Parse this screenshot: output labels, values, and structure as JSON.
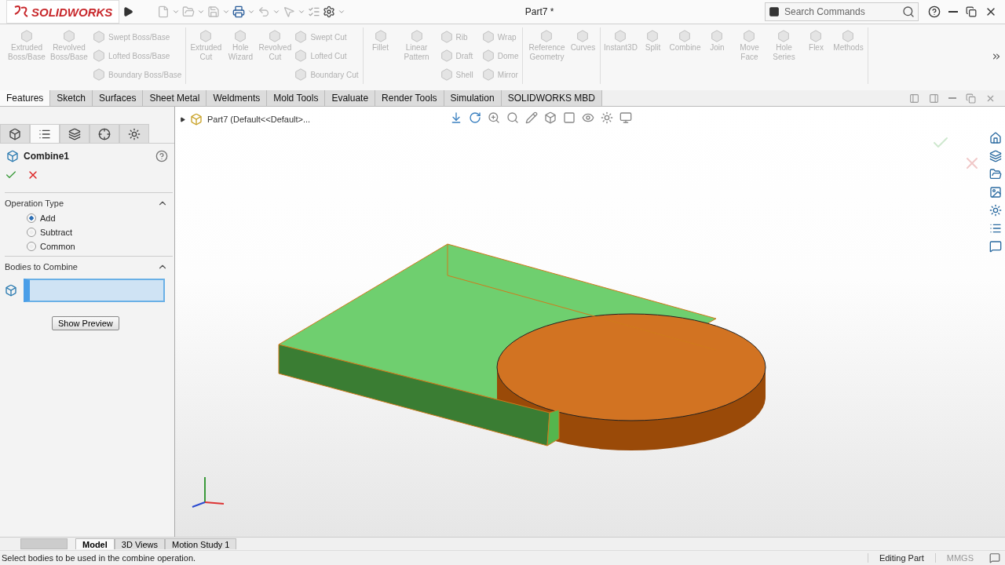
{
  "title_bar": {
    "app_name": "SOLIDWORKS",
    "document_title": "Part7 *",
    "search": {
      "placeholder": "Search Commands"
    }
  },
  "ribbon": [
    {
      "items": [
        {
          "label": "Extruded Boss/Base",
          "kind": "large",
          "disabled": true
        },
        {
          "label": "Revolved Boss/Base",
          "kind": "large",
          "disabled": true
        },
        {
          "label": "Swept Boss/Base",
          "kind": "small",
          "disabled": true
        },
        {
          "label": "Lofted Boss/Base",
          "kind": "small",
          "disabled": true
        },
        {
          "label": "Boundary Boss/Base",
          "kind": "small",
          "disabled": true
        }
      ]
    },
    {
      "items": [
        {
          "label": "Extruded Cut",
          "kind": "large",
          "disabled": true
        },
        {
          "label": "Hole Wizard",
          "kind": "large",
          "disabled": true
        },
        {
          "label": "Revolved Cut",
          "kind": "large",
          "disabled": true
        },
        {
          "label": "Swept Cut",
          "kind": "small",
          "disabled": true
        },
        {
          "label": "Lofted Cut",
          "kind": "small",
          "disabled": true
        },
        {
          "label": "Boundary Cut",
          "kind": "small",
          "disabled": true
        }
      ]
    },
    {
      "items": [
        {
          "label": "Fillet",
          "kind": "large",
          "disabled": true
        },
        {
          "label": "Linear Pattern",
          "kind": "large",
          "disabled": true
        },
        {
          "label": "Rib",
          "kind": "small",
          "disabled": true
        },
        {
          "label": "Draft",
          "kind": "small",
          "disabled": true
        },
        {
          "label": "Shell",
          "kind": "small",
          "disabled": true
        },
        {
          "label": "Wrap",
          "kind": "small",
          "disabled": true
        },
        {
          "label": "Dome",
          "kind": "small",
          "disabled": true
        },
        {
          "label": "Mirror",
          "kind": "small",
          "disabled": true
        }
      ]
    },
    {
      "items": [
        {
          "label": "Reference Geometry",
          "kind": "large",
          "disabled": true
        },
        {
          "label": "Curves",
          "kind": "large",
          "disabled": true
        }
      ]
    },
    {
      "items": [
        {
          "label": "Instant3D",
          "kind": "large",
          "disabled": true
        },
        {
          "label": "Split",
          "kind": "large",
          "disabled": true
        },
        {
          "label": "Combine",
          "kind": "large",
          "disabled": true
        },
        {
          "label": "Join",
          "kind": "large",
          "disabled": true
        },
        {
          "label": "Move Face",
          "kind": "large",
          "disabled": true
        },
        {
          "label": "Hole Series",
          "kind": "large",
          "disabled": true
        },
        {
          "label": "Flex",
          "kind": "large",
          "disabled": true
        },
        {
          "label": "Methods",
          "kind": "large",
          "disabled": true
        }
      ]
    }
  ],
  "command_tabs": [
    {
      "label": "Features",
      "selected": true
    },
    {
      "label": "Sketch",
      "selected": false
    },
    {
      "label": "Surfaces",
      "selected": false
    },
    {
      "label": "Sheet Metal",
      "selected": false
    },
    {
      "label": "Weldments",
      "selected": false
    },
    {
      "label": "Mold Tools",
      "selected": false
    },
    {
      "label": "Evaluate",
      "selected": false
    },
    {
      "label": "Render Tools",
      "selected": false
    },
    {
      "label": "Simulation",
      "selected": false
    },
    {
      "label": "SOLIDWORKS MBD",
      "selected": false
    }
  ],
  "panel_tabs": [
    {
      "selected": false
    },
    {
      "selected": true
    },
    {
      "selected": false
    },
    {
      "selected": false
    },
    {
      "selected": false
    }
  ],
  "property_manager": {
    "feature_name": "Combine1",
    "sections": [
      {
        "title": "Operation Type",
        "expanded": true,
        "kind": "options",
        "options": [
          {
            "label": "Add",
            "selected": true
          },
          {
            "label": "Subtract",
            "selected": false
          },
          {
            "label": "Common",
            "selected": false
          }
        ]
      },
      {
        "title": "Bodies to Combine",
        "expanded": true,
        "kind": "selection",
        "active": true,
        "button": "Show Preview"
      }
    ]
  },
  "tree": {
    "root": "Part7  (Default<<Default>..."
  },
  "bottom_tabs": [
    {
      "label": "Model",
      "selected": true
    },
    {
      "label": "3D Views",
      "selected": false
    },
    {
      "label": "Motion Study 1",
      "selected": false
    }
  ],
  "status_bar": {
    "message": "Select bodies to be used in the combine operation.",
    "mode": "Editing Part",
    "units": "MMGS"
  }
}
